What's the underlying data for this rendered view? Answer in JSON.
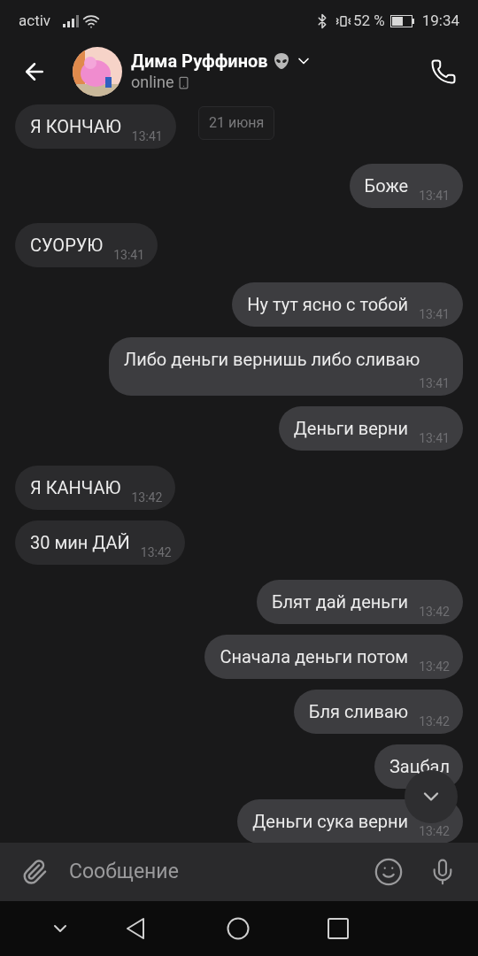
{
  "status_bar": {
    "carrier": "activ",
    "battery": "52 %",
    "time": "19:34"
  },
  "header": {
    "name": "Дима Руффинов",
    "status": "online"
  },
  "date_badge": "21 июня",
  "messages": [
    {
      "kind": "incoming",
      "text": "Я КОНЧАЮ",
      "time": "13:41"
    },
    {
      "kind": "outgoing",
      "text": "Боже",
      "time": "13:41"
    },
    {
      "kind": "incoming",
      "text": "СУОРУЮ",
      "time": "13:41"
    },
    {
      "kind": "outgoing",
      "text": "Ну тут ясно с тобой",
      "time": "13:41"
    },
    {
      "kind": "outgoing",
      "text": "Либо деньги вернишь либо сливаю",
      "time": "13:41"
    },
    {
      "kind": "outgoing",
      "text": "Деньги верни",
      "time": "13:41"
    },
    {
      "kind": "incoming",
      "text": "Я КАНЧАЮ",
      "time": "13:42"
    },
    {
      "kind": "incoming",
      "text": "30 мин ДАЙ",
      "time": "13:42"
    },
    {
      "kind": "outgoing",
      "text": "Блят дай деньги",
      "time": "13:42"
    },
    {
      "kind": "outgoing",
      "text": "Сначала деньги потом",
      "time": "13:42"
    },
    {
      "kind": "outgoing",
      "text": "Бля сливаю",
      "time": "13:42"
    },
    {
      "kind": "outgoing",
      "text": "Зацбал"
    },
    {
      "kind": "outgoing",
      "text": "Деньги сука верни",
      "time": "13:42"
    }
  ],
  "composer": {
    "placeholder": "Сообщение"
  }
}
